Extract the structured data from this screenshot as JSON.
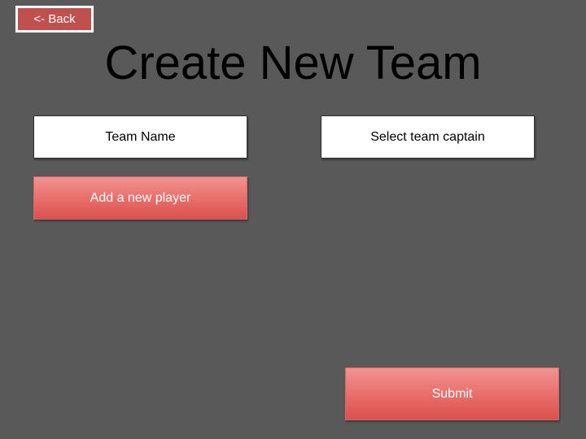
{
  "header": {
    "back_label": "<- Back",
    "title": "Create New Team"
  },
  "form": {
    "team_name_label": "Team Name",
    "captain_label": "Select team captain",
    "add_player_label": "Add a new player",
    "submit_label": "Submit"
  },
  "colors": {
    "background": "#595959",
    "accent": "#e9706c",
    "back_button": "#c0504d"
  }
}
